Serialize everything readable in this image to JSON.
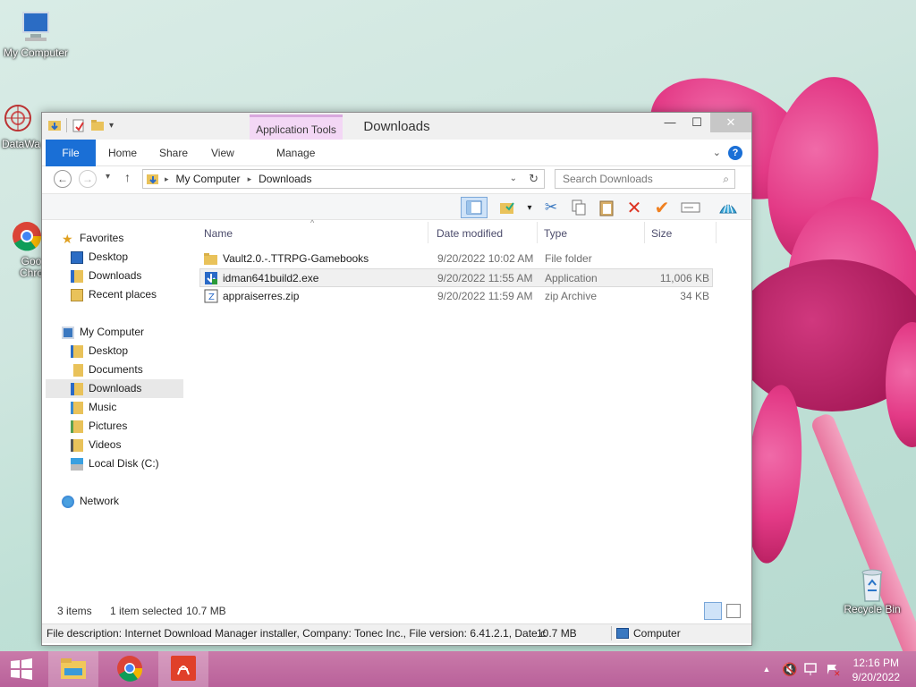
{
  "desktop": {
    "icons": [
      {
        "label": "My Computer",
        "icon": "computer-icon"
      },
      {
        "label": "DataWa",
        "icon": "datawatch-icon"
      },
      {
        "label": "Goo\nChro",
        "icon": "chrome-icon"
      },
      {
        "label": "Recycle Bin",
        "icon": "recycle-bin-icon"
      }
    ]
  },
  "window": {
    "title": "Downloads",
    "context_tab": "Application Tools",
    "ribbon_tabs": [
      "File",
      "Home",
      "Share",
      "View",
      "Manage"
    ],
    "controls": {
      "minimize": "—",
      "maximize": "☐",
      "close": "✕"
    },
    "address": {
      "root": "My Computer",
      "current": "Downloads"
    },
    "search_placeholder": "Search Downloads",
    "nav": {
      "favorites_header": "Favorites",
      "favorites": [
        "Desktop",
        "Downloads",
        "Recent places"
      ],
      "computer_header": "My Computer",
      "computer_items": [
        "Desktop",
        "Documents",
        "Downloads",
        "Music",
        "Pictures",
        "Videos",
        "Local Disk (C:)"
      ],
      "network": "Network"
    },
    "columns": [
      "Name",
      "Date modified",
      "Type",
      "Size"
    ],
    "files": [
      {
        "name": "Vault2.0.-.TTRPG-Gamebooks",
        "date": "9/20/2022 10:02 AM",
        "type": "File folder",
        "size": "",
        "icon": "folder-icon"
      },
      {
        "name": "idman641build2.exe",
        "date": "9/20/2022 11:55 AM",
        "type": "Application",
        "size": "11,006 KB",
        "icon": "installer-icon"
      },
      {
        "name": "appraiserres.zip",
        "date": "9/20/2022 11:59 AM",
        "type": "zip Archive",
        "size": "34 KB",
        "icon": "zip-icon"
      }
    ],
    "status": {
      "items": "3 items",
      "selected": "1 item selected",
      "size": "10.7 MB"
    },
    "info": {
      "description": "File description: Internet Download Manager installer, Company: Tonec Inc., File version: 6.41.2.1, Date c",
      "size": "10.7 MB",
      "location": "Computer"
    }
  },
  "taskbar": {
    "start": "windows-start-icon",
    "apps": [
      "file-explorer-icon",
      "chrome-icon",
      "acrobat-icon"
    ],
    "time": "12:16 PM",
    "date": "9/20/2022"
  },
  "colors": {
    "accent": "#1a6fd6",
    "context": "#f3d7f5",
    "taskbar": "#c06fa0"
  }
}
